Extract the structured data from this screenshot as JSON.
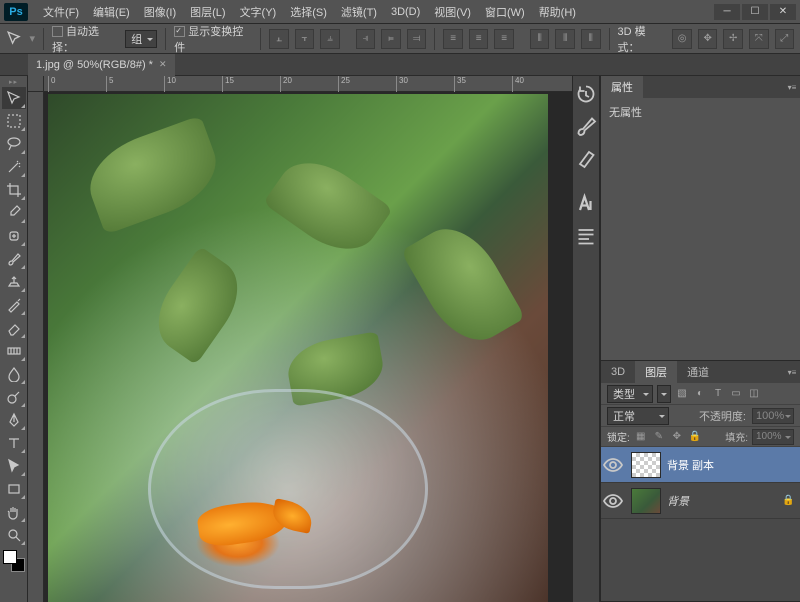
{
  "menu": {
    "items": [
      "文件(F)",
      "编辑(E)",
      "图像(I)",
      "图层(L)",
      "文字(Y)",
      "选择(S)",
      "滤镜(T)",
      "3D(D)",
      "视图(V)",
      "窗口(W)",
      "帮助(H)"
    ]
  },
  "options": {
    "auto_select_label": "自动选择：",
    "auto_select_value": "组",
    "show_transform_label": "显示变换控件",
    "mode3d_label": "3D 模式："
  },
  "document": {
    "tab_title": "1.jpg @ 50%(RGB/8#) *",
    "ruler_marks": [
      "0",
      "5",
      "10",
      "15",
      "20",
      "25",
      "30",
      "35",
      "40"
    ]
  },
  "panels": {
    "properties_tab": "属性",
    "no_properties": "无属性",
    "tabs_3d": "3D",
    "tabs_layers": "图层",
    "tabs_channels": "通道",
    "kind_label": "类型",
    "blend_mode": "正常",
    "opacity_label": "不透明度:",
    "opacity_value": "100%",
    "lock_label": "锁定:",
    "fill_label": "填充:",
    "fill_value": "100%"
  },
  "layers": [
    {
      "name": "背景 副本",
      "locked": false,
      "thumb": "checker"
    },
    {
      "name": "背景",
      "locked": true,
      "thumb": "img",
      "italic": true
    }
  ]
}
